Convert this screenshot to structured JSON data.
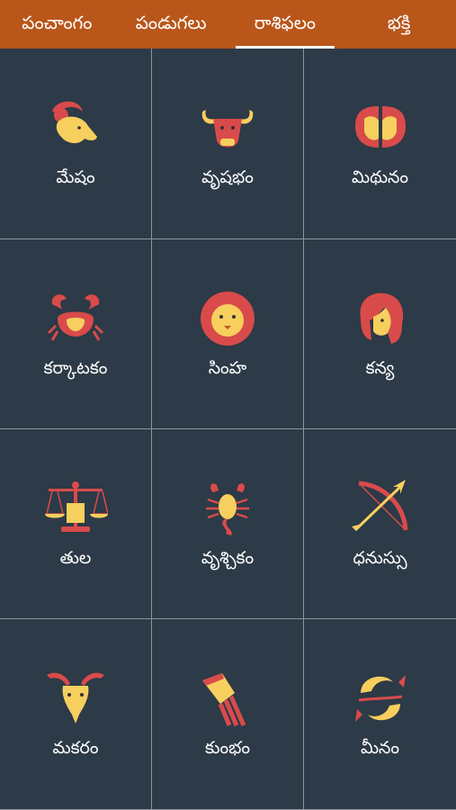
{
  "tabs": [
    {
      "label": "పంచాంగం",
      "active": false
    },
    {
      "label": "పండుగలు",
      "active": false
    },
    {
      "label": "రాశిఫలం",
      "active": true
    },
    {
      "label": "భక్తి",
      "active": false
    }
  ],
  "signs": [
    {
      "name": "మేషం",
      "icon": "aries-ram-icon"
    },
    {
      "name": "వృషభం",
      "icon": "taurus-bull-icon"
    },
    {
      "name": "మిథునం",
      "icon": "gemini-twins-icon"
    },
    {
      "name": "కర్కాటకం",
      "icon": "cancer-crab-icon"
    },
    {
      "name": "సింహ",
      "icon": "leo-lion-icon"
    },
    {
      "name": "కన్య",
      "icon": "virgo-maiden-icon"
    },
    {
      "name": "తుల",
      "icon": "libra-scales-icon"
    },
    {
      "name": "వృశ్చికం",
      "icon": "scorpio-scorpion-icon"
    },
    {
      "name": "ధనుస్సు",
      "icon": "sagittarius-bow-icon"
    },
    {
      "name": "మకరం",
      "icon": "capricorn-goat-icon"
    },
    {
      "name": "కుంభం",
      "icon": "aquarius-pot-icon"
    },
    {
      "name": "మీనం",
      "icon": "pisces-fish-icon"
    }
  ],
  "colors": {
    "header": "#b9561a",
    "background": "#2d3a47",
    "icon_red": "#d94b4b",
    "icon_gold": "#f7cf5e"
  }
}
